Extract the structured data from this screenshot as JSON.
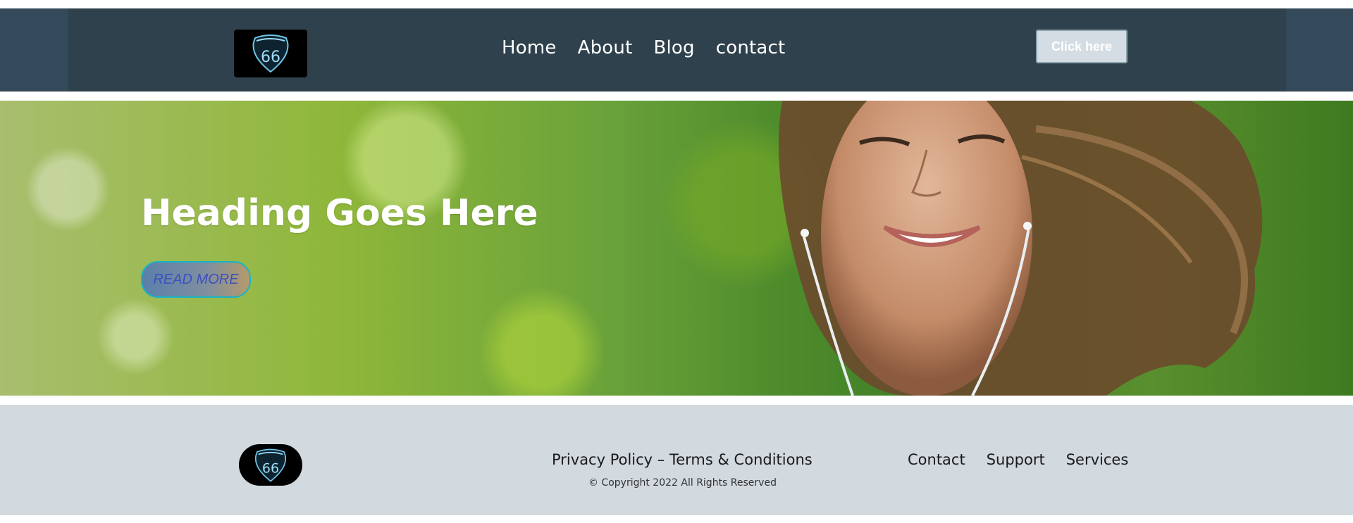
{
  "header": {
    "logo_text": "66",
    "nav": [
      "Home",
      "About",
      "Blog",
      "contact"
    ],
    "cta_label": "Click here"
  },
  "hero": {
    "heading": "Heading Goes Here",
    "button_label": "READ MORE"
  },
  "footer": {
    "logo_text": "66",
    "privacy_link": "Privacy Policy",
    "separator": " – ",
    "terms_link": "Terms & Conditions",
    "copyright": "© Copyright 2022 All Rights Reserved",
    "nav": [
      "Contact",
      "Support",
      "Services"
    ]
  },
  "colors": {
    "header_bg": "#2f414c",
    "footer_bg": "#d2d9df",
    "accent_border": "#19b3c6"
  }
}
